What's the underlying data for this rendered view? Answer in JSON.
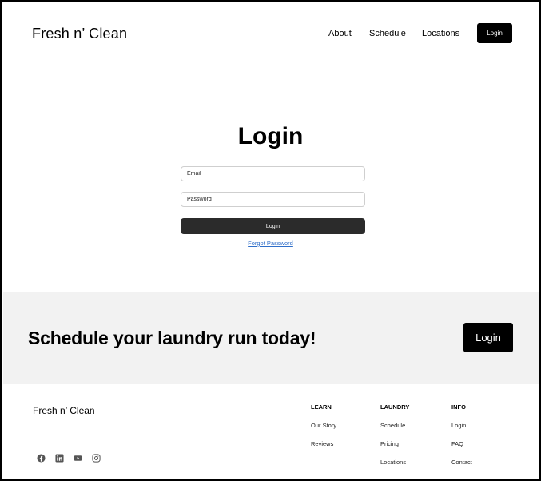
{
  "header": {
    "brand": "Fresh n’ Clean",
    "nav": [
      "About",
      "Schedule",
      "Locations"
    ],
    "login_button": "Login"
  },
  "login_form": {
    "title": "Login",
    "email_placeholder": "Email",
    "password_placeholder": "Password",
    "submit_label": "Login",
    "forgot_link": "Forgot Password"
  },
  "cta": {
    "title": "Schedule your laundry run today!",
    "button": "Login"
  },
  "footer": {
    "brand": "Fresh n’ Clean",
    "social_icons": [
      "facebook-icon",
      "linkedin-icon",
      "youtube-icon",
      "instagram-icon"
    ],
    "columns": [
      {
        "heading": "LEARN",
        "links": [
          "Our Story",
          "Reviews"
        ]
      },
      {
        "heading": "LAUNDRY",
        "links": [
          "Schedule",
          "Pricing",
          "Locations"
        ]
      },
      {
        "heading": "INFO",
        "links": [
          "Login",
          "FAQ",
          "Contact"
        ]
      }
    ]
  },
  "colors": {
    "primary_button": "#000000",
    "submit_button": "#2b2b2b",
    "cta_background": "#f2f2f2",
    "link": "#2f6ec9",
    "social_icon": "#555555"
  }
}
